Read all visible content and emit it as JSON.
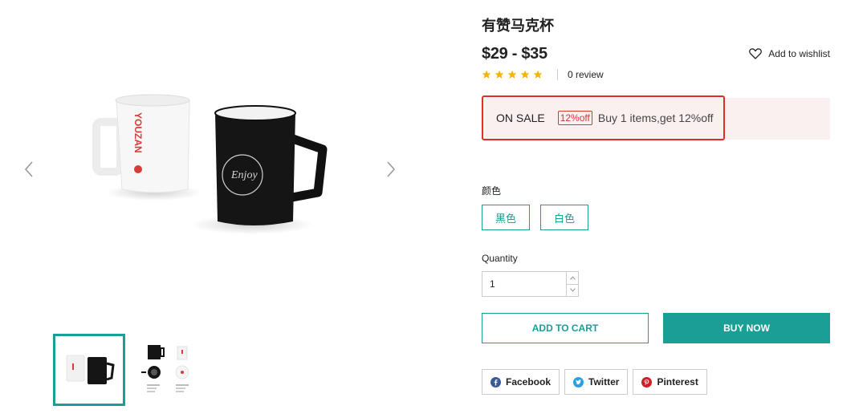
{
  "product": {
    "title": "有赞马克杯",
    "price": "$29 - $35",
    "wishlist_label": "Add to wishlist",
    "rating_stars": 5,
    "review_label": "0 review"
  },
  "promo": {
    "sale_label": "ON SALE",
    "tag": "12%off",
    "description": "Buy 1 items,get 12%off"
  },
  "options": {
    "color_label": "颜色",
    "colors": [
      "黑色",
      "白色"
    ]
  },
  "quantity": {
    "label": "Quantity",
    "value": "1"
  },
  "actions": {
    "add_to_cart": "ADD TO CART",
    "buy_now": "BUY NOW"
  },
  "share": {
    "facebook": "Facebook",
    "twitter": "Twitter",
    "pinterest": "Pinterest"
  },
  "mug_white": {
    "brand_text": "YOUZAN"
  },
  "mug_black": {
    "logo_text": "Enjoy"
  },
  "colors": {
    "accent": "#1a9e95",
    "sale_red": "#e02b2b",
    "promo_bg": "#fbf0f0",
    "star": "#f5b50a"
  }
}
